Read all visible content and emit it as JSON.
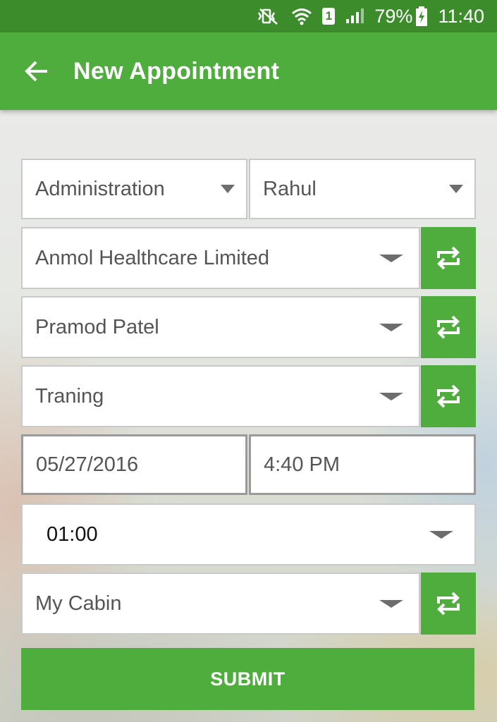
{
  "status_bar": {
    "battery": "79%",
    "time": "11:40",
    "sim_slot": "1"
  },
  "app_bar": {
    "title": "New Appointment"
  },
  "form": {
    "department": "Administration",
    "employee": "Rahul",
    "company": "Anmol Healthcare Limited",
    "contact": "Pramod Patel",
    "purpose": "Traning",
    "date": "05/27/2016",
    "time": "4:40 PM",
    "duration": "01:00",
    "location": "My Cabin"
  },
  "submit_label": "SUBMIT",
  "colors": {
    "primary": "#4fad3d",
    "status_bar": "#3c8c2c"
  }
}
